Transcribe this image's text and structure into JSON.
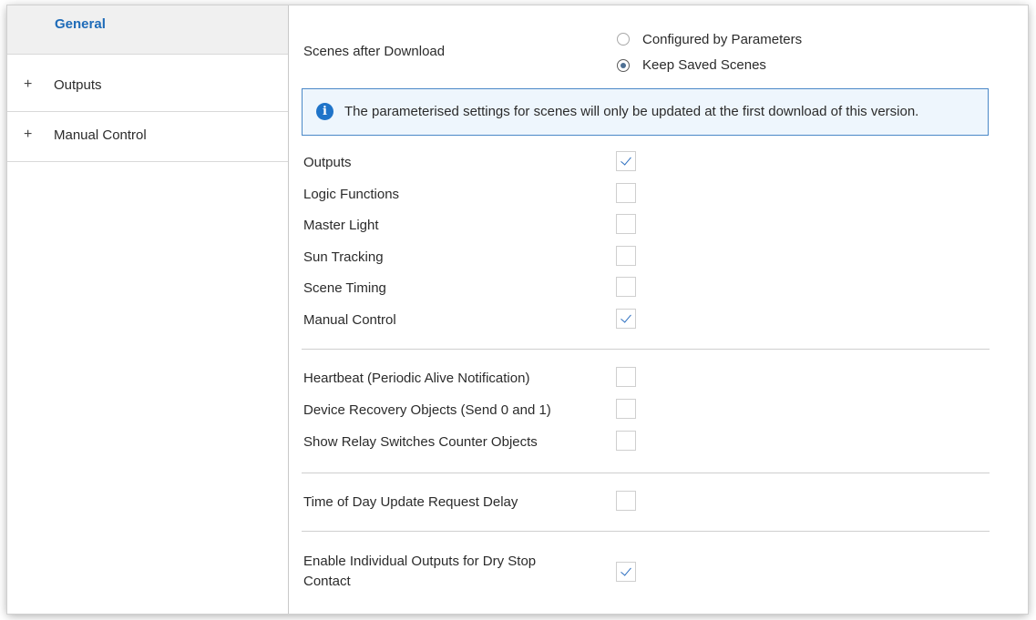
{
  "sidebar": {
    "items": [
      {
        "label": "General",
        "expander": ""
      },
      {
        "label": "Outputs",
        "expander": "+"
      },
      {
        "label": "Manual Control",
        "expander": "+"
      }
    ]
  },
  "scenes": {
    "label": "Scenes after Download",
    "options": [
      {
        "label": "Configured by Parameters",
        "selected": false
      },
      {
        "label": "Keep Saved Scenes",
        "selected": true
      }
    ]
  },
  "info": {
    "icon": "info-icon",
    "text": "The parameterised settings for scenes will only be updated at the first download of this version."
  },
  "scene_checks": [
    {
      "label": "Outputs",
      "checked": true
    },
    {
      "label": "Logic Functions",
      "checked": false
    },
    {
      "label": "Master Light",
      "checked": false
    },
    {
      "label": "Sun Tracking",
      "checked": false
    },
    {
      "label": "Scene Timing",
      "checked": false
    },
    {
      "label": "Manual Control",
      "checked": true
    }
  ],
  "object_checks": [
    {
      "label": "Heartbeat (Periodic Alive Notification)",
      "checked": false
    },
    {
      "label": "Device Recovery Objects (Send 0 and 1)",
      "checked": false
    },
    {
      "label": "Show Relay Switches Counter Objects",
      "checked": false
    }
  ],
  "time_check": {
    "label": "Time of Day Update Request Delay",
    "checked": false
  },
  "dry_stop": {
    "label_line1": "Enable Individual Outputs for Dry Stop",
    "label_line2": "Contact",
    "checked": true
  },
  "colors": {
    "accent": "#1e6bb8",
    "info_border": "#4a88c7",
    "info_bg": "#eef6fd"
  }
}
